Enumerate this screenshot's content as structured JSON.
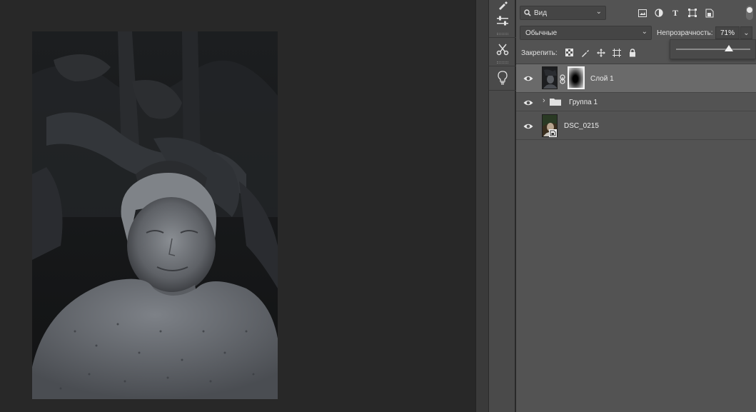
{
  "canvas": {
    "photo_description_alt": "portrait-photo"
  },
  "tools": {
    "items": [
      {
        "name": "brush-tool-icon"
      },
      {
        "name": "adjustments-icon"
      },
      {
        "name": "scissors-tools-icon"
      },
      {
        "name": "lightbulb-icon"
      }
    ]
  },
  "layers_panel": {
    "kind_filter": {
      "value": "Вид",
      "icon": "search-icon"
    },
    "filter_icons": [
      "image-filter-icon",
      "adjustment-filter-icon",
      "type-filter-icon",
      "shape-filter-icon",
      "smart-object-filter-icon"
    ],
    "blend_mode": "Обычные",
    "opacity_label": "Непрозрачность:",
    "opacity_value": "71%",
    "opacity_fraction": 0.71,
    "lock_label": "Закрепить:",
    "lock_icons": [
      "lock-transparent-pixels-icon",
      "lock-image-pixels-icon",
      "lock-position-icon",
      "lock-artboard-icon",
      "lock-all-icon"
    ],
    "layers": [
      {
        "name": "Слой 1",
        "selected": true,
        "has_mask": true,
        "type": "pixel"
      },
      {
        "name": "Группа 1",
        "selected": false,
        "type": "group"
      },
      {
        "name": "DSC_0215",
        "selected": false,
        "type": "smart-object"
      }
    ]
  },
  "colors": {
    "canvas_bg": "#282828",
    "panel_bg": "#535353",
    "selected_row": "#6a6a6a"
  }
}
